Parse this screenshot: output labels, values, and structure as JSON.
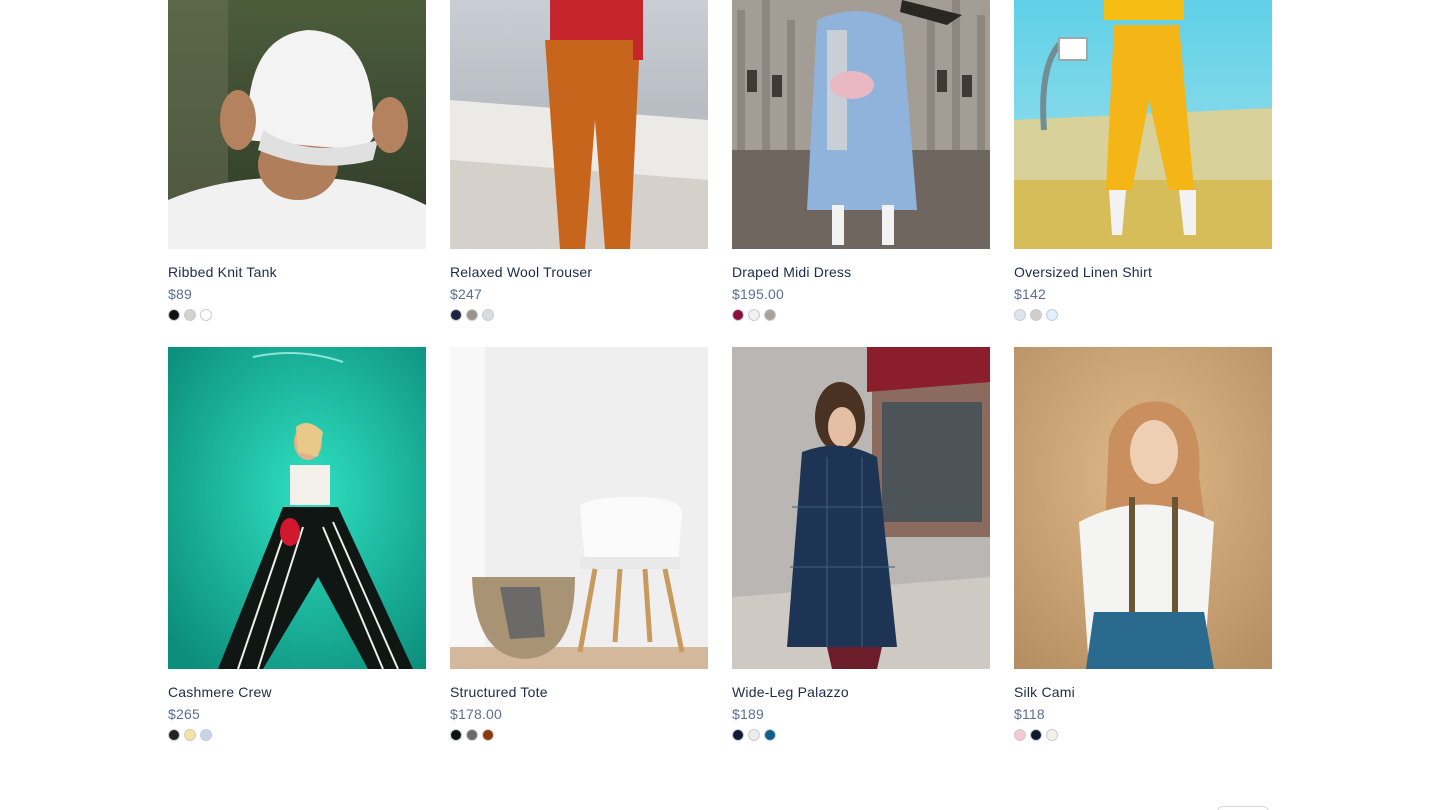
{
  "products": [
    {
      "name": "Ribbed Knit Tank",
      "price": "$89",
      "image": "man-white-cap-photo",
      "swatches": [
        "#111111",
        "#d4d0cb",
        "#ffffff"
      ]
    },
    {
      "name": "Relaxed Wool Trouser",
      "price": "$247",
      "image": "orange-trousers-photo",
      "swatches": [
        "#1b2340",
        "#9c9489",
        "#dcdcdc"
      ]
    },
    {
      "name": "Draped Midi Dress",
      "price": "$195.00",
      "image": "blue-coat-cathedral-photo",
      "swatches": [
        "#8a0f3b",
        "#f1f1f1",
        "#a8a197"
      ]
    },
    {
      "name": "Oversized Linen Shirt",
      "price": "$142",
      "image": "yellow-tracksuit-photo",
      "swatches": [
        "#dfe5ee",
        "#d0ccc6",
        "#dff1fd"
      ]
    },
    {
      "name": "Cashmere Crew",
      "price": "$265",
      "image": "teal-wall-striped-pants-photo",
      "swatches": [
        "#222222",
        "#f6e3a1",
        "#c7d3e6"
      ]
    },
    {
      "name": "Structured Tote",
      "price": "$178.00",
      "image": "white-chair-basket-photo",
      "swatches": [
        "#111111",
        "#6d6a66",
        "#8b3a0b"
      ]
    },
    {
      "name": "Wide-Leg Palazzo",
      "price": "$189",
      "image": "plaid-coat-street-photo",
      "swatches": [
        "#141a33",
        "#ececec",
        "#0f5f8d"
      ]
    },
    {
      "name": "Silk Cami",
      "price": "$118",
      "image": "white-shirt-suspenders-photo",
      "swatches": [
        "#f6c8cf",
        "#111a2e",
        "#f3f1ec"
      ]
    }
  ]
}
